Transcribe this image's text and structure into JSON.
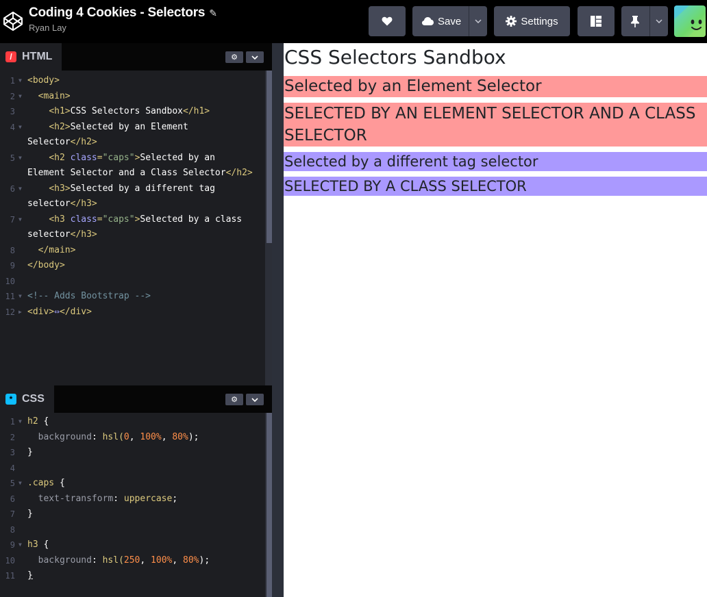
{
  "header": {
    "title": "Coding 4 Cookies - Selectors",
    "author": "Ryan Lay",
    "save_label": "Save",
    "settings_label": "Settings"
  },
  "html_pane": {
    "tab_label": "HTML",
    "lines": [
      {
        "n": "1"
      },
      {
        "n": "2"
      },
      {
        "n": "3"
      },
      {
        "n": "4"
      },
      {
        "n": "5"
      },
      {
        "n": "6"
      },
      {
        "n": "7"
      },
      {
        "n": "8"
      },
      {
        "n": "9"
      },
      {
        "n": "10"
      },
      {
        "n": "11"
      },
      {
        "n": "12"
      }
    ],
    "code": {
      "body_open": "<body>",
      "main_open": "<main>",
      "h1_open": "<h1>",
      "h1_text": "CSS Selectors Sandbox",
      "h1_close": "</h1>",
      "h2a_open": "<h2>",
      "h2a_text": "Selected by an Element Selector",
      "h2_close": "</h2>",
      "h2b_tag": "<h2 ",
      "class_attr": "class",
      "eq": "=",
      "caps_str": "\"caps\"",
      "gt": ">",
      "h2b_text": "Selected by an Element Selector and a Class Selector",
      "h3a_open": "<h3>",
      "h3a_text": "Selected by a different tag selector",
      "h3_close": "</h3>",
      "h3b_tag": "<h3 ",
      "h3b_text": "Selected by a class selector",
      "main_close": "</main>",
      "body_close": "</body>",
      "comment": "<!-- Adds Bootstrap -->",
      "div_open": "<div>",
      "div_ellipsis": "⇔",
      "div_close": "</div>"
    }
  },
  "css_pane": {
    "tab_label": "CSS",
    "lines": [
      {
        "n": "1"
      },
      {
        "n": "2"
      },
      {
        "n": "3"
      },
      {
        "n": "4"
      },
      {
        "n": "5"
      },
      {
        "n": "6"
      },
      {
        "n": "7"
      },
      {
        "n": "8"
      },
      {
        "n": "9"
      },
      {
        "n": "10"
      },
      {
        "n": "11"
      }
    ],
    "code": {
      "sel_h2": "h2",
      "brace_open": "{",
      "brace_close": "}",
      "prop_bg": "background",
      "prop_tt": "text-transform",
      "colon": ":",
      "fn_hsl": "hsl(",
      "n0": "0",
      "n100": "100%",
      "n80": "80%",
      "n250": "250",
      "comma": ", ",
      "close_paren": ");",
      "sel_caps": ".caps",
      "val_upper": "uppercase",
      "semicolon": ";",
      "sel_h3": "h3"
    }
  },
  "preview": {
    "h1": "CSS Selectors Sandbox",
    "h2_plain": "Selected by an Element Selector",
    "h2_caps": "Selected by an Element Selector and a Class Selector",
    "h3_plain": "Selected by a different tag selector",
    "h3_caps": "Selected by a class selector"
  },
  "colors": {
    "h2_background": "#ff9999",
    "h3_background": "#aa99ff",
    "editor_bg": "#1d1e22",
    "header_button": "#444857"
  },
  "icons": {
    "logo": "codepen-logo",
    "heart": "heart-icon",
    "cloud": "cloud-icon",
    "gear": "gear-icon",
    "layout": "layout-icon",
    "pin": "pin-icon",
    "chevron": "chevron-down-icon",
    "pencil": "pencil-icon"
  }
}
